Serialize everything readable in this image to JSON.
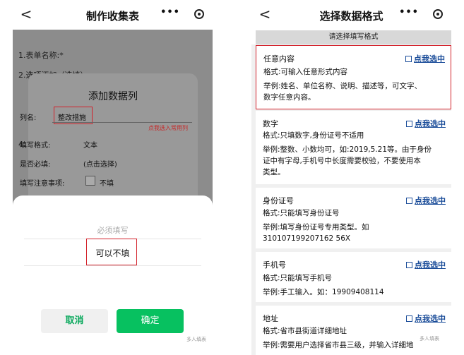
{
  "left": {
    "nav": {
      "back": "<",
      "title": "制作收集表",
      "more": "•••"
    },
    "background": {
      "line1": "1.表单名称:*",
      "line2": "2.选项添加（选填）",
      "line3": "4."
    },
    "dialog": {
      "title": "添加数据列",
      "column_name_label": "列名:",
      "column_name_value": "整改措施",
      "pick_common": "点我选入常用列",
      "format_label": "填写格式:",
      "format_value": "文本",
      "required_label": "是否必填:",
      "required_value": "(点击选择)",
      "note_label": "填写注意事项:",
      "note_value": "不填"
    },
    "sheet": {
      "option_disabled": "必须填写",
      "option_selected": "可以不填",
      "cancel": "取消",
      "confirm": "确定",
      "watermark": "多人填表"
    }
  },
  "right": {
    "nav": {
      "back": "<",
      "title": "选择数据格式",
      "more": "•••"
    },
    "section_header": "请选择填写格式",
    "select_label": "点我选中",
    "cards": [
      {
        "title": "任意内容",
        "format": "格式:可输入任意形式内容",
        "example_lines": [
          "举例:姓名、单位名称、说明、描述等，可文字、",
          "数字任意内容。"
        ]
      },
      {
        "title": "数字",
        "format": "格式:只填数字,身份证号不适用",
        "example_lines": [
          "举例:整数、小数均可，如:2019,5.21等。由于身份",
          "证中有字母,手机号中长度需要校验，不要使用本",
          "类型。"
        ]
      },
      {
        "title": "身份证号",
        "format": "格式:只能填写身份证号",
        "example_lines": [
          "举例:填写身份证号专用类型。如",
          "310107199207162 56X"
        ]
      },
      {
        "title": "手机号",
        "format": "格式:只能填写手机号",
        "example_lines": [
          "举例:手工输入。如：19909408114"
        ]
      },
      {
        "title": "地址",
        "format": "格式:省市县街道详细地址",
        "example_lines": [
          "举例:需要用户选择省市县三级，并输入详细地"
        ]
      }
    ],
    "watermark": "多人填表"
  }
}
